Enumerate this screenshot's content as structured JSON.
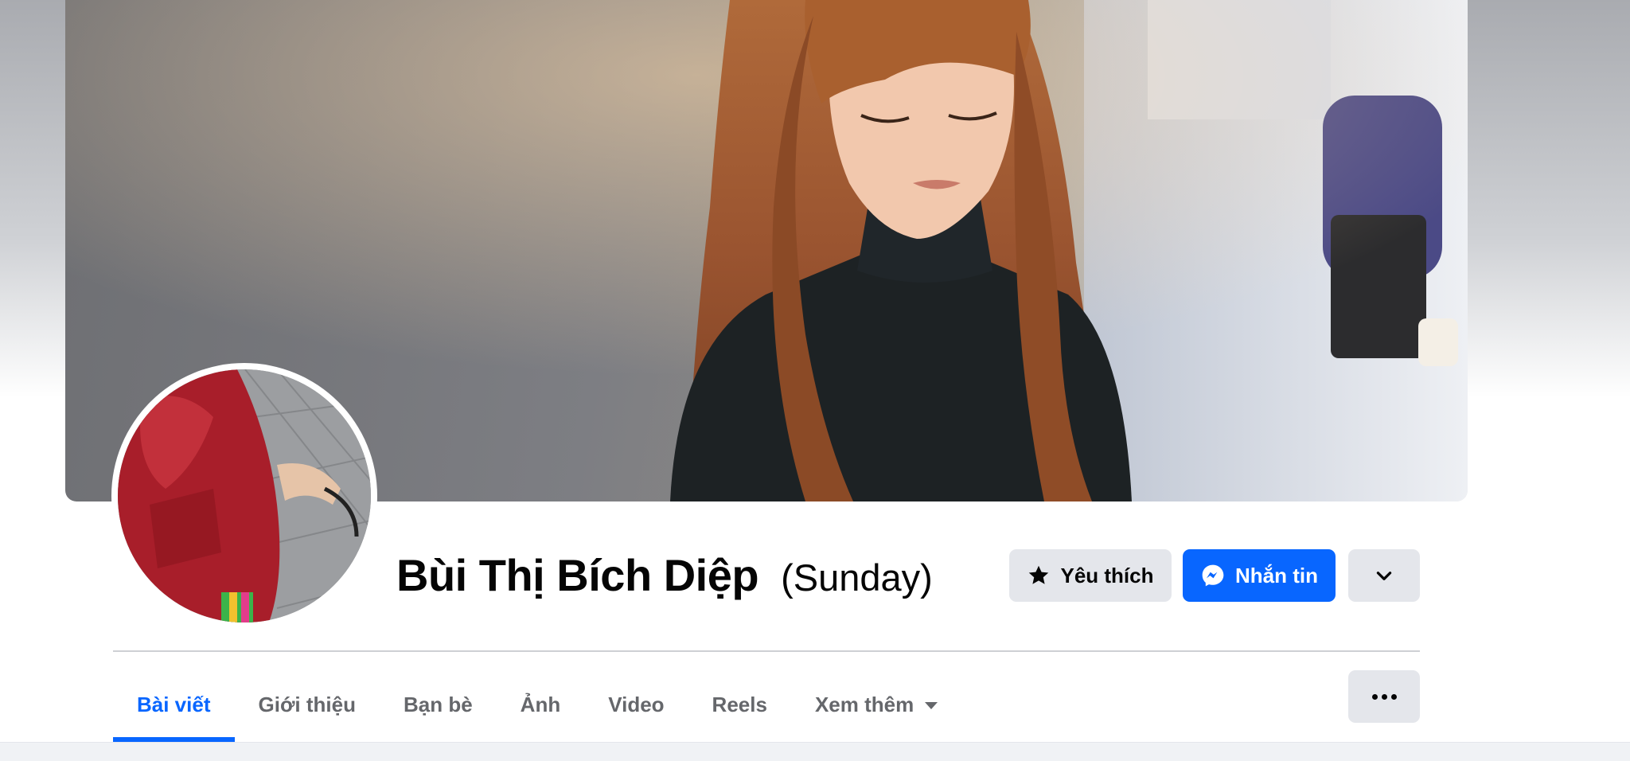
{
  "profile": {
    "name": "Bùi Thị Bích Diệp",
    "alternate_name": "(Sunday)"
  },
  "actions": {
    "favorite_label": "Yêu thích",
    "message_label": "Nhắn tin",
    "dropdown_icon": "chevron-down-icon"
  },
  "tabs": [
    {
      "label": "Bài viết",
      "active": true
    },
    {
      "label": "Giới thiệu",
      "active": false
    },
    {
      "label": "Bạn bè",
      "active": false
    },
    {
      "label": "Ảnh",
      "active": false
    },
    {
      "label": "Video",
      "active": false
    },
    {
      "label": "Reels",
      "active": false
    },
    {
      "label": "Xem thêm",
      "active": false,
      "has_dropdown": true
    }
  ],
  "colors": {
    "accent": "#0866ff",
    "button_gray": "#e4e6eb",
    "text_primary": "#050505",
    "text_secondary": "#65676b"
  }
}
